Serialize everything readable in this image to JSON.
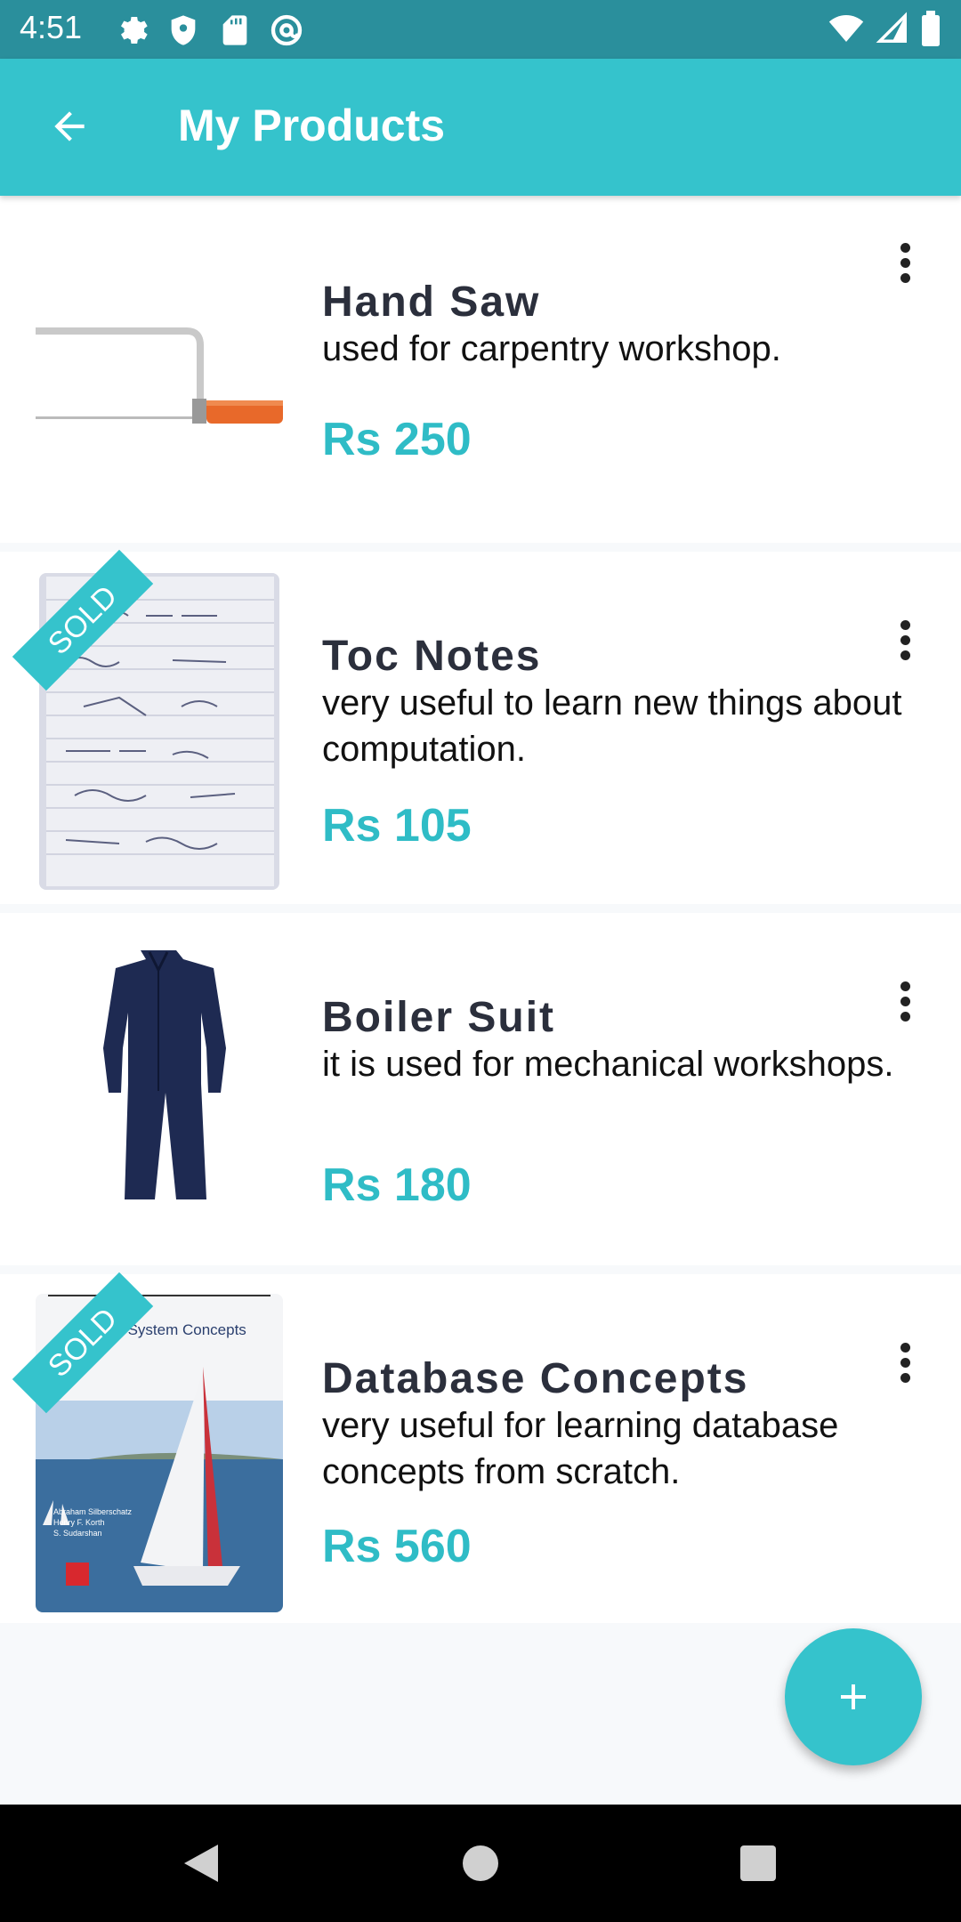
{
  "status_bar": {
    "time": "4:51",
    "left_icons": [
      "settings-icon",
      "shield-icon",
      "sd-card-icon",
      "at-sign-icon"
    ],
    "right_icons": [
      "wifi-icon",
      "signal-icon",
      "battery-icon"
    ]
  },
  "app_bar": {
    "title": "My Products",
    "back_icon": "arrow-back-icon"
  },
  "products": [
    {
      "title": "Hand Saw",
      "description": "used for carpentry workshop.",
      "price": "Rs 250",
      "sold": false
    },
    {
      "title": "Toc Notes",
      "description": "very useful to learn new things about computation.",
      "price": "Rs 105",
      "sold": true,
      "sold_label": "SOLD"
    },
    {
      "title": "Boiler Suit",
      "description": "it is used for mechanical workshops.",
      "price": "Rs 180",
      "sold": false
    },
    {
      "title": "Database Concepts",
      "description": "very useful for learning database concepts from scratch.",
      "price": "Rs 560",
      "sold": true,
      "sold_label": "SOLD",
      "cover_text": "base System Concepts",
      "cover_authors": [
        "Abraham Silberschatz",
        "Henry F. Korth",
        "S. Sudarshan"
      ]
    }
  ],
  "fab": {
    "icon": "add-icon"
  },
  "nav_bar": {
    "icons": [
      "back-triangle-icon",
      "home-circle-icon",
      "recents-square-icon"
    ]
  },
  "colors": {
    "accent": "#35c3cc",
    "status_bar": "#2a8f9c",
    "price": "#2fbcc6",
    "title_text": "#2b2f3c"
  }
}
